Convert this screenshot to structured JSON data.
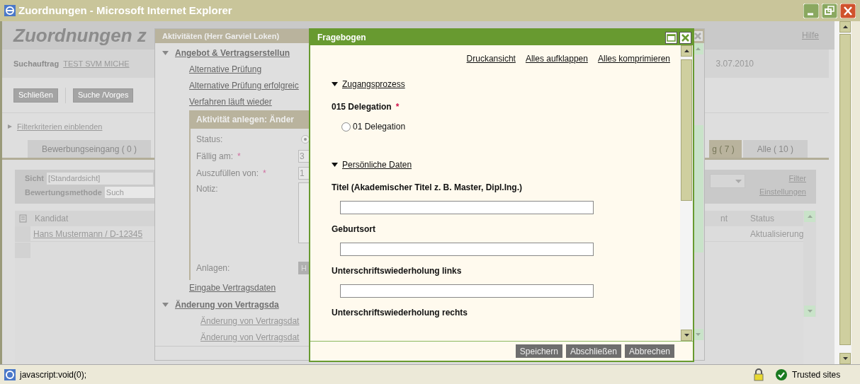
{
  "window": {
    "title": "Zuordnungen - Microsoft Internet Explorer"
  },
  "page": {
    "heading": "Zuordnungen z",
    "help_link": "Hilfe",
    "search_order_label": "Suchauftrag",
    "search_order_value": "TEST SVM MICHE",
    "date": "3.07.2010",
    "buttons": [
      "Schließen",
      "Suche /Vorges"
    ],
    "filter_toggle": "Filterkriterien einblenden",
    "tabs": [
      {
        "label": "Bewerbungseingang ( 0 )",
        "selected": false
      },
      {
        "label": "g ( 7 )",
        "selected": true
      },
      {
        "label": "Alle ( 10 )",
        "selected": false
      }
    ],
    "view_label": "Sicht",
    "view_value": "[Standardsicht]",
    "method_label": "Bewertungsmethode",
    "method_value": "Such",
    "filter_links": [
      "Filter",
      "Einstellungen"
    ],
    "table": {
      "columns": [
        "Kandidat",
        "nt",
        "Status"
      ],
      "rows": [
        [
          "Hans Mustermann / D-12345",
          "",
          "Aktualisierung"
        ]
      ]
    }
  },
  "activities_dialog": {
    "title": "Aktivitäten (Herr Garviel Loken)",
    "groups": [
      {
        "label": "Angebot & Vertragserstellun",
        "expanded": true,
        "items": [
          {
            "label": "Alternative Prüfung",
            "disabled": false
          },
          {
            "label": "Alternative Prüfung erfolgreic",
            "disabled": false
          },
          {
            "label": "Verfahren läuft wieder",
            "disabled": false
          }
        ]
      }
    ],
    "subpanel": {
      "title": "Aktivität anlegen: Änder",
      "fields": [
        {
          "label": "Status:",
          "kind": "radio",
          "checked": true
        },
        {
          "label": "Fällig am:",
          "required_mark": "*",
          "kind": "text",
          "value": "3"
        },
        {
          "label": "Auszufüllen von:",
          "required_mark": "*",
          "kind": "text",
          "value": "1"
        },
        {
          "label": "Notiz:",
          "kind": "textarea"
        },
        {
          "label": "Anlagen:",
          "kind": "button",
          "value": "H"
        }
      ]
    },
    "after_items": [
      {
        "label": "Eingabe Vertragsdaten",
        "disabled": false
      }
    ],
    "groups_after": [
      {
        "label": "Änderung von Vertragsda",
        "expanded": true,
        "items": [
          {
            "label": "Änderung von Vertragsdat",
            "disabled": true
          },
          {
            "label": "Änderung von Vertragsdat",
            "disabled": true
          }
        ]
      }
    ]
  },
  "questionnaire": {
    "title": "Fragebogen",
    "links": [
      "Druckansicht",
      "Alles aufklappen",
      "Alles komprimieren"
    ],
    "sections": [
      {
        "title": "Zugangsprozess",
        "expanded": true,
        "questions": [
          {
            "label": "015 Delegation",
            "required_mark": "*",
            "kind": "radio",
            "options": [
              {
                "label": "01 Delegation",
                "selected": false
              }
            ]
          }
        ]
      },
      {
        "title": "Persönliche Daten",
        "expanded": true,
        "questions": [
          {
            "label": "Titel (Akademischer Titel z. B. Master, Dipl.Ing.)",
            "kind": "text"
          },
          {
            "label": "Geburtsort",
            "kind": "text"
          },
          {
            "label": "Unterschriftswiederholung links",
            "kind": "text"
          },
          {
            "label": "Unterschriftswiederholung rechts",
            "kind": "heading"
          }
        ]
      }
    ],
    "buttons": [
      "Speichern",
      "Abschließen",
      "Abbrechen"
    ]
  },
  "status_bar": {
    "text": "javascript:void(0);",
    "zone": "Trusted sites"
  }
}
